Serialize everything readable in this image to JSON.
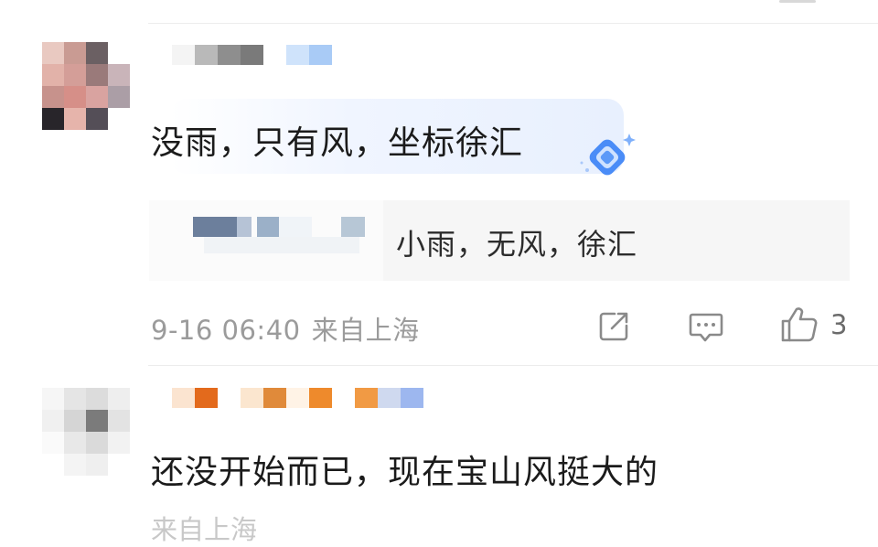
{
  "comments": [
    {
      "text": "没雨，只有风，坐标徐汇",
      "reply": {
        "text": "小雨，无风，徐汇"
      },
      "date": "9-16 06:40",
      "location": "来自上海",
      "like_count": "3"
    },
    {
      "text": "还没开始而已，现在宝山风挺大的",
      "location_partial": "来自上海"
    }
  ],
  "icons": {
    "share": "share-icon",
    "comment": "comment-icon",
    "like": "thumbs-up-icon",
    "badge": "diamond-badge-icon"
  },
  "colors": {
    "meta_text": "#9b9b9b",
    "reply_bg": "#f6f6f6",
    "badge_blue": "#4a8cf7"
  }
}
